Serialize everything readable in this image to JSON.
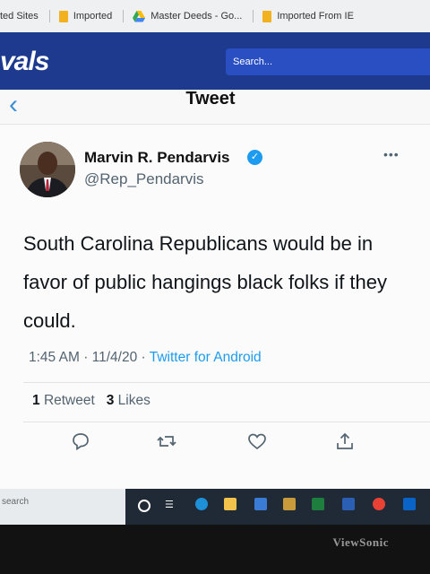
{
  "bookmarks": [
    {
      "label": "ted Sites",
      "icon": "none"
    },
    {
      "label": "Imported",
      "icon": "folder-icon"
    },
    {
      "label": "Master Deeds - Go...",
      "icon": "google-drive-icon"
    },
    {
      "label": "Imported From IE",
      "icon": "folder-icon"
    }
  ],
  "site": {
    "logo_text": "vals",
    "search_placeholder": "Search..."
  },
  "tweet": {
    "header_title": "Tweet",
    "display_name": "Marvin R. Pendarvis",
    "handle": "@Rep_Pendarvis",
    "text": "South Carolina Republicans would be in favor of public hangings black folks if they could.",
    "time": "1:45 AM",
    "date": "11/4/20",
    "source": "Twitter for Android",
    "retweet_count": "1",
    "retweet_label": "Retweet",
    "like_count": "3",
    "like_label": "Likes"
  },
  "taskbar": {
    "search_text": "search"
  },
  "monitor": {
    "brand": "ViewSonic"
  },
  "colors": {
    "header_blue": "#1d3a8f",
    "twitter_blue": "#1d9bf0"
  }
}
